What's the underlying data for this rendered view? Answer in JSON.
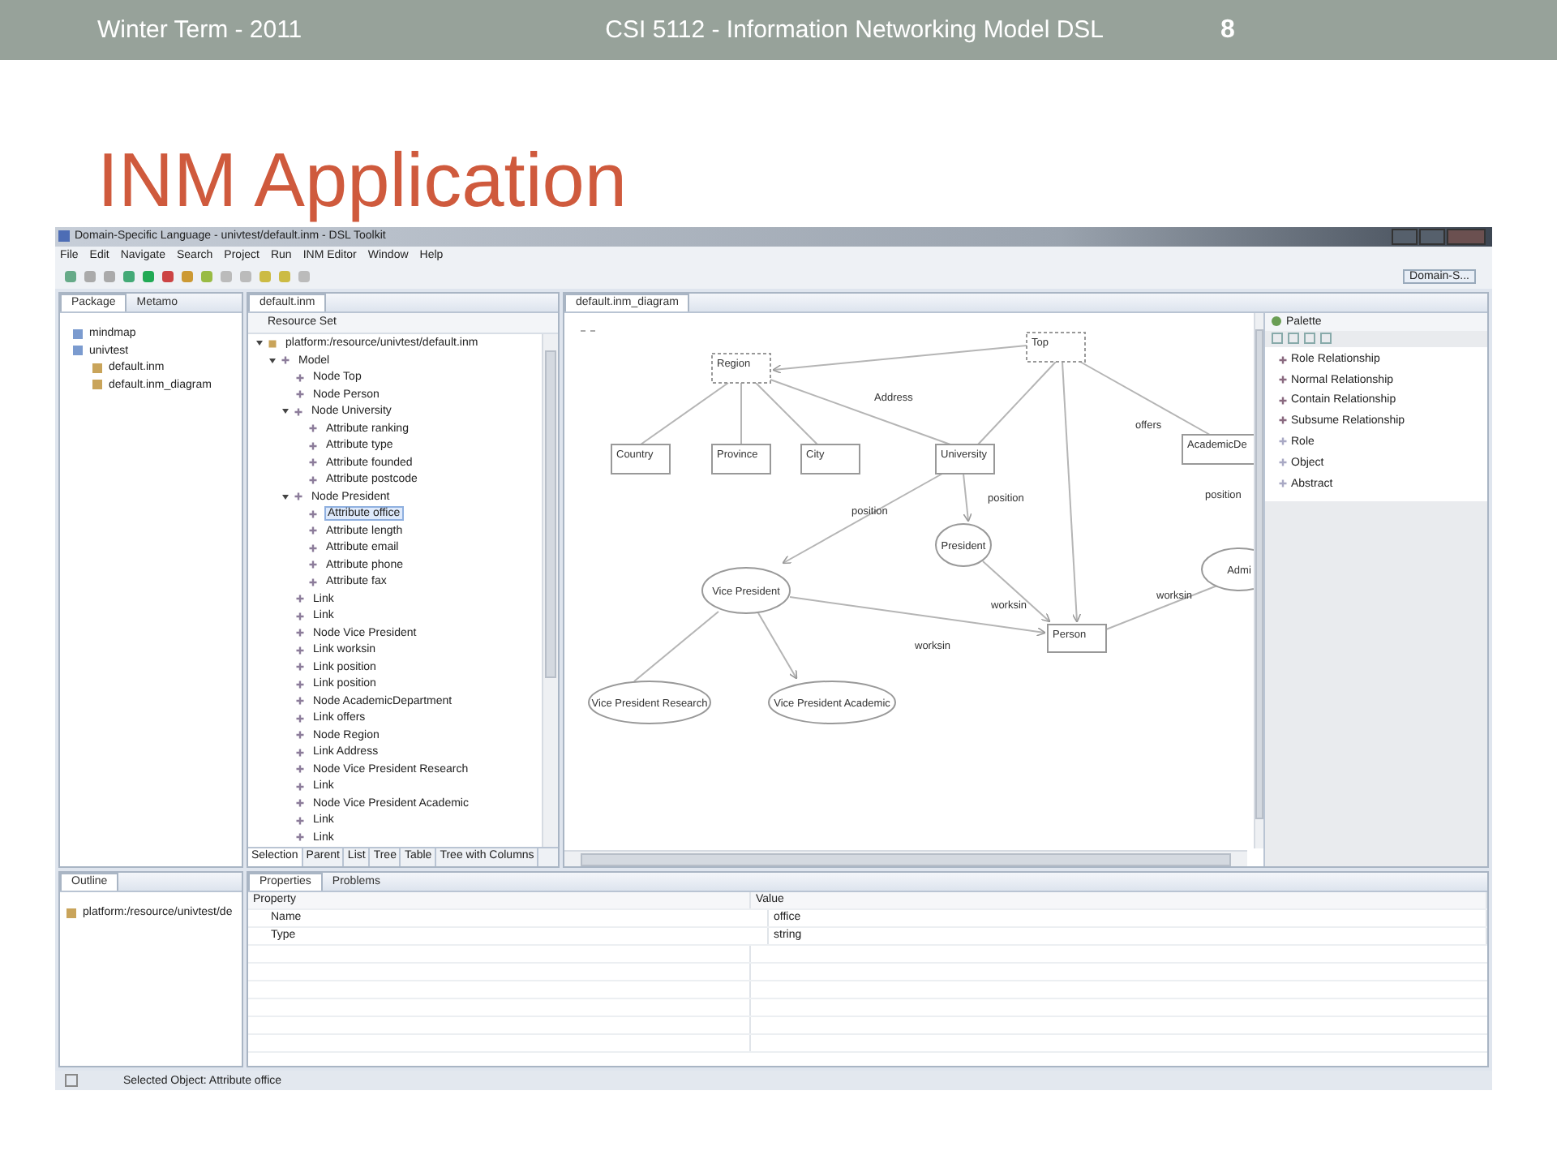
{
  "slide": {
    "header": {
      "term": "Winter Term - 2011",
      "course": "CSI 5112 - Information Networking Model DSL",
      "page": "8"
    },
    "title": "INM Application"
  },
  "window": {
    "title": "Domain-Specific Language - univtest/default.inm - DSL Toolkit"
  },
  "menu": [
    "File",
    "Edit",
    "Navigate",
    "Search",
    "Project",
    "Run",
    "INM Editor",
    "Window",
    "Help"
  ],
  "perspective": "Domain-S...",
  "package_panel": {
    "tabs": [
      {
        "label": "Package",
        "selected": true
      },
      {
        "label": "Metamo",
        "selected": false
      }
    ],
    "tree": [
      {
        "label": "mindmap",
        "kind": "project"
      },
      {
        "label": "univtest",
        "kind": "project",
        "children": [
          {
            "label": "default.inm",
            "kind": "file"
          },
          {
            "label": "default.inm_diagram",
            "kind": "file"
          }
        ]
      }
    ]
  },
  "editor": {
    "tab": "default.inm",
    "header": "Resource Set",
    "tree": [
      {
        "label": "platform:/resource/univtest/default.inm",
        "selected": false,
        "expanded": true,
        "children": [
          {
            "label": "Model",
            "selected": false,
            "expanded": true,
            "children": [
              {
                "label": "Node Top",
                "selected": false
              },
              {
                "label": "Node Person",
                "selected": false
              },
              {
                "label": "Node University",
                "selected": false,
                "expanded": true,
                "children": [
                  {
                    "label": "Attribute ranking",
                    "selected": false
                  },
                  {
                    "label": "Attribute type",
                    "selected": false
                  },
                  {
                    "label": "Attribute founded",
                    "selected": false
                  },
                  {
                    "label": "Attribute postcode",
                    "selected": false
                  }
                ]
              },
              {
                "label": "Node President",
                "selected": false,
                "expanded": true,
                "children": [
                  {
                    "label": "Attribute office",
                    "selected": true
                  },
                  {
                    "label": "Attribute length",
                    "selected": false
                  },
                  {
                    "label": "Attribute email",
                    "selected": false
                  },
                  {
                    "label": "Attribute phone",
                    "selected": false
                  },
                  {
                    "label": "Attribute fax",
                    "selected": false
                  }
                ]
              },
              {
                "label": "Link",
                "selected": false
              },
              {
                "label": "Link",
                "selected": false
              },
              {
                "label": "Node Vice President",
                "selected": false
              },
              {
                "label": "Link worksin",
                "selected": false
              },
              {
                "label": "Link position",
                "selected": false
              },
              {
                "label": "Link position",
                "selected": false
              },
              {
                "label": "Node AcademicDepartment",
                "selected": false
              },
              {
                "label": "Link offers",
                "selected": false
              },
              {
                "label": "Node Region",
                "selected": false
              },
              {
                "label": "Link Address",
                "selected": false
              },
              {
                "label": "Node Vice President Research",
                "selected": false
              },
              {
                "label": "Link",
                "selected": false
              },
              {
                "label": "Node Vice President Academic",
                "selected": false
              },
              {
                "label": "Link",
                "selected": false
              },
              {
                "label": "Link",
                "selected": false
              }
            ]
          }
        ]
      }
    ],
    "view_tabs": [
      {
        "label": "Selection",
        "selected": true
      },
      {
        "label": "Parent",
        "selected": false
      },
      {
        "label": "List",
        "selected": false
      },
      {
        "label": "Tree",
        "selected": false
      },
      {
        "label": "Table",
        "selected": false
      },
      {
        "label": "Tree with Columns",
        "selected": false
      }
    ]
  },
  "diagram": {
    "tab": "default.inm_diagram",
    "nodes": [
      {
        "label": "Top",
        "kind": "abstract"
      },
      {
        "label": "Region",
        "kind": "abstract"
      },
      {
        "label": "Country",
        "kind": "object"
      },
      {
        "label": "Province",
        "kind": "object"
      },
      {
        "label": "City",
        "kind": "object"
      },
      {
        "label": "University",
        "kind": "object"
      },
      {
        "label": "AcademicDe",
        "kind": "object"
      },
      {
        "label": "President",
        "kind": "role"
      },
      {
        "label": "Vice President",
        "kind": "role"
      },
      {
        "label": "Admi",
        "kind": "role"
      },
      {
        "label": "Person",
        "kind": "object"
      },
      {
        "label": "Vice President Research",
        "kind": "role"
      },
      {
        "label": "Vice President Academic",
        "kind": "role"
      }
    ],
    "edge_labels": [
      "Address",
      "offers",
      "position",
      "position",
      "position",
      "worksin",
      "worksin",
      "worksin"
    ]
  },
  "palette": {
    "title": "Palette",
    "items": [
      {
        "label": "Role Relationship",
        "kind": "relationship"
      },
      {
        "label": "Normal Relationship",
        "kind": "relationship"
      },
      {
        "label": "Contain Relationship",
        "kind": "relationship"
      },
      {
        "label": "Subsume Relationship",
        "kind": "relationship"
      },
      {
        "label": "Role",
        "kind": "element"
      },
      {
        "label": "Object",
        "kind": "element"
      },
      {
        "label": "Abstract",
        "kind": "element"
      }
    ]
  },
  "outline": {
    "tab": "Outline",
    "items": [
      "platform:/resource/univtest/de"
    ]
  },
  "properties": {
    "tabs": [
      {
        "label": "Properties",
        "selected": true
      },
      {
        "label": "Problems",
        "selected": false
      }
    ],
    "columns": [
      "Property",
      "Value"
    ],
    "rows": [
      {
        "property": "Name",
        "value": "office"
      },
      {
        "property": "Type",
        "value": "string"
      }
    ]
  },
  "status_bar": "Selected Object: Attribute office"
}
